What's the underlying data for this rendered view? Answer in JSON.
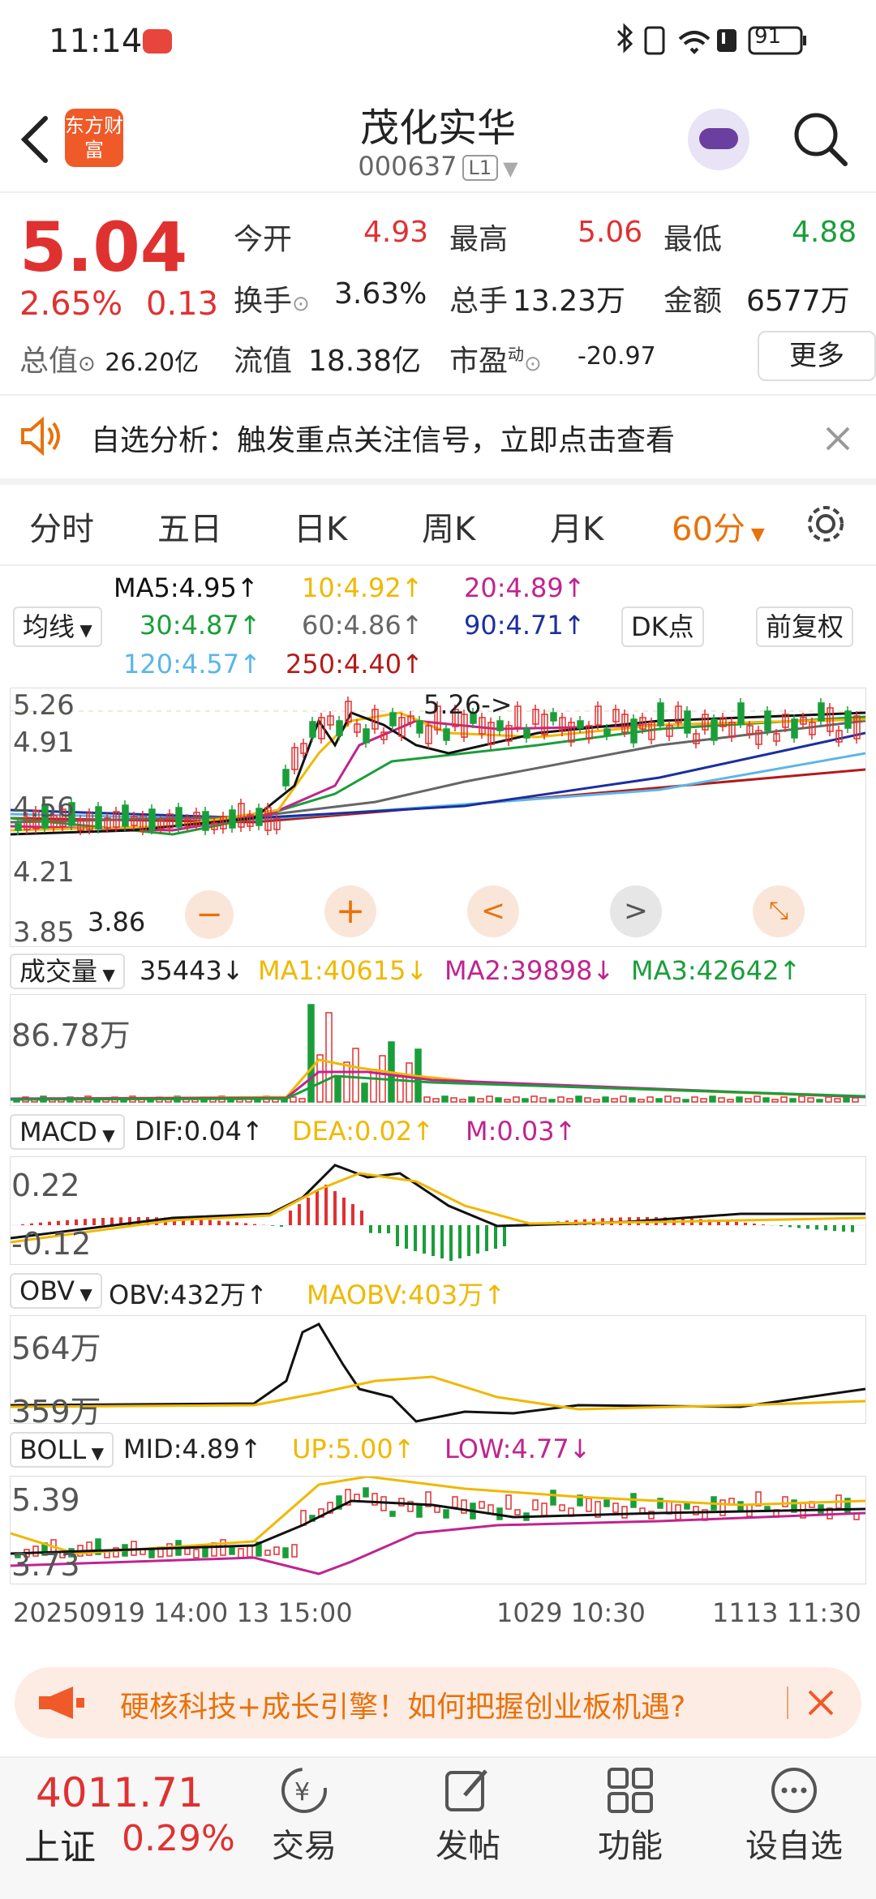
{
  "status_bar": {
    "time": "11:14",
    "battery": "91",
    "icons": [
      "bluetooth-icon",
      "vibrate-icon",
      "wifi-icon",
      "alert-icon",
      "battery-icon"
    ]
  },
  "header": {
    "title": "茂化实华",
    "code": "000637",
    "market_tag": "L1",
    "logo_text": "东方财富"
  },
  "quote": {
    "price": "5.04",
    "change_pct": "2.65%",
    "change": "0.13",
    "open_label": "今开",
    "open": "4.93",
    "high_label": "最高",
    "high": "5.06",
    "low_label": "最低",
    "low": "4.88",
    "turnover_label": "换手",
    "turnover": "3.63%",
    "volume_label": "总手",
    "volume": "13.23万",
    "amount_label": "金额",
    "amount": "6577万",
    "total_cap_label": "总值",
    "total_cap": "26.20亿",
    "float_cap_label": "流值",
    "float_cap": "18.38亿",
    "pe_label": "市盈",
    "pe_sup": "动",
    "pe": "-20.97",
    "more": "更多"
  },
  "alert": {
    "text": "自选分析：触发重点关注信号，立即点击查看"
  },
  "tabs": [
    "分时",
    "五日",
    "日K",
    "周K",
    "月K",
    "60分"
  ],
  "active_tab": "60分",
  "ma": {
    "selector": "均线",
    "ma5": "MA5:4.95↑",
    "ma10": "10:4.92↑",
    "ma20": "20:4.89↑",
    "ma30": "30:4.87↑",
    "ma60": "60:4.86↑",
    "ma90": "90:4.71↑",
    "ma120": "120:4.57↑",
    "ma250": "250:4.40↑",
    "dk_button": "DK点",
    "adjust_button": "前复权"
  },
  "colors": {
    "up": "#e03131",
    "down": "#1a9e3a",
    "accent": "#e8720c",
    "ma5": "#111111",
    "ma10": "#f0b800",
    "ma20": "#c0248f",
    "ma30": "#1a9e3a",
    "ma60": "#666666",
    "ma90": "#1c2f9e",
    "ma120": "#5bb6e8",
    "ma250": "#b31b1b"
  },
  "main_chart": {
    "y_labels": [
      "5.26",
      "4.91",
      "4.56",
      "4.21",
      "3.85"
    ],
    "peak_label": "5.26->",
    "trough_label": "3.86"
  },
  "volume": {
    "selector": "成交量",
    "vol": "35443↓",
    "ma1": "MA1:40615↓",
    "ma2": "MA2:39898↓",
    "ma3": "MA3:42642↑",
    "y_label": "86.78万"
  },
  "macd": {
    "selector": "MACD",
    "dif": "DIF:0.04↑",
    "dea": "DEA:0.02↑",
    "m": "M:0.03↑",
    "y_top": "0.22",
    "y_bottom": "-0.12"
  },
  "obv": {
    "selector": "OBV",
    "obv": "OBV:432万↑",
    "maobv": "MAOBV:403万↑",
    "y_top": "564万",
    "y_bottom": "359万"
  },
  "boll": {
    "selector": "BOLL",
    "mid": "MID:4.89↑",
    "up": "UP:5.00↑",
    "low": "LOW:4.77↓",
    "y_top": "5.39",
    "y_bottom": "3.73"
  },
  "x_axis": [
    "20250919 14:00",
    "13 15:00",
    "1029 10:30",
    "1113 11:30"
  ],
  "banner": {
    "text": "硬核科技+成长引擎！如何把握创业板机遇?"
  },
  "bottom_nav": {
    "index_value": "4011.71",
    "index_name": "上证",
    "index_change": "0.29%",
    "items": [
      "交易",
      "发帖",
      "功能",
      "设自选"
    ]
  }
}
